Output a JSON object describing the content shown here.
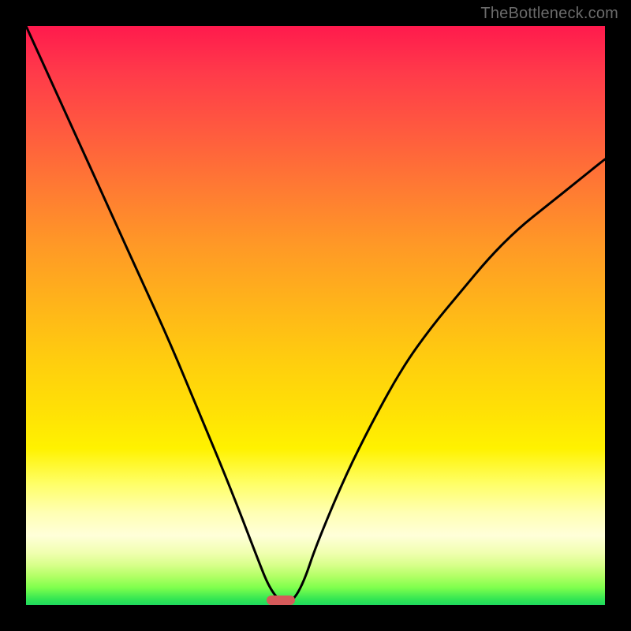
{
  "watermark": "TheBottleneck.com",
  "colors": {
    "frame": "#000000",
    "curve": "#000000",
    "marker": "#d65a5a"
  },
  "chart_data": {
    "type": "line",
    "title": "",
    "xlabel": "",
    "ylabel": "",
    "xlim": [
      0,
      100
    ],
    "ylim": [
      0,
      100
    ],
    "grid": false,
    "legend": false,
    "series": [
      {
        "name": "bottleneck-curve",
        "x": [
          0,
          5,
          10,
          15,
          20,
          25,
          30,
          35,
          40,
          42,
          44,
          46,
          48,
          50,
          55,
          60,
          65,
          70,
          75,
          80,
          85,
          90,
          95,
          100
        ],
        "y": [
          100,
          89,
          78,
          67,
          56,
          45,
          33,
          21,
          8,
          3,
          0.5,
          0.5,
          4,
          10,
          22,
          32,
          41,
          48,
          54,
          60,
          65,
          69,
          73,
          77
        ]
      }
    ],
    "marker": {
      "x": 44,
      "y": 0,
      "width": 5,
      "height": 1.6
    },
    "gradient_stops": [
      {
        "pos": 0.0,
        "color": "#ff1a4d"
      },
      {
        "pos": 0.5,
        "color": "#ffce0e"
      },
      {
        "pos": 0.85,
        "color": "#ffffd9"
      },
      {
        "pos": 1.0,
        "color": "#1fd95e"
      }
    ]
  }
}
